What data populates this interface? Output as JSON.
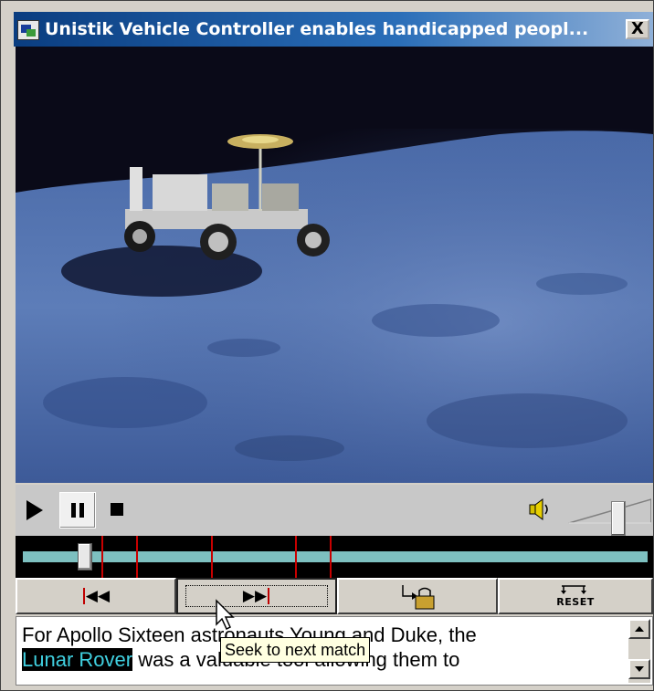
{
  "window": {
    "title": "Unistik Vehicle Controller enables handicapped peopl...",
    "close_glyph": "X"
  },
  "video": {
    "scene": "lunar-rover-on-moon-surface",
    "colors": {
      "sky": "#0a0a16",
      "ground": "#5a7ab4"
    }
  },
  "player": {
    "icons": [
      "play-icon",
      "pause-icon",
      "stop-icon",
      "speaker-icon"
    ],
    "volume_level": 0.55,
    "playback_position": 0.1
  },
  "timeline": {
    "track_color": "#7dc0c0",
    "tick_color": "#c80000",
    "match_ticks_fraction": [
      0.135,
      0.19,
      0.31,
      0.45,
      0.51
    ]
  },
  "buttons": {
    "prev_match_glyph": "⏮",
    "next_match_glyph": "⏭",
    "bookmark_icon": "bookmark-lock-icon",
    "reset_label": "RESET"
  },
  "transcript": {
    "line1_prefix": "For Apollo Sixteen astronauts Young and Duke, the",
    "highlight": "Lunar Rover",
    "line2_suffix": " was a valuable tool allowing them to"
  },
  "tooltip": {
    "text": "Seek to next match"
  }
}
